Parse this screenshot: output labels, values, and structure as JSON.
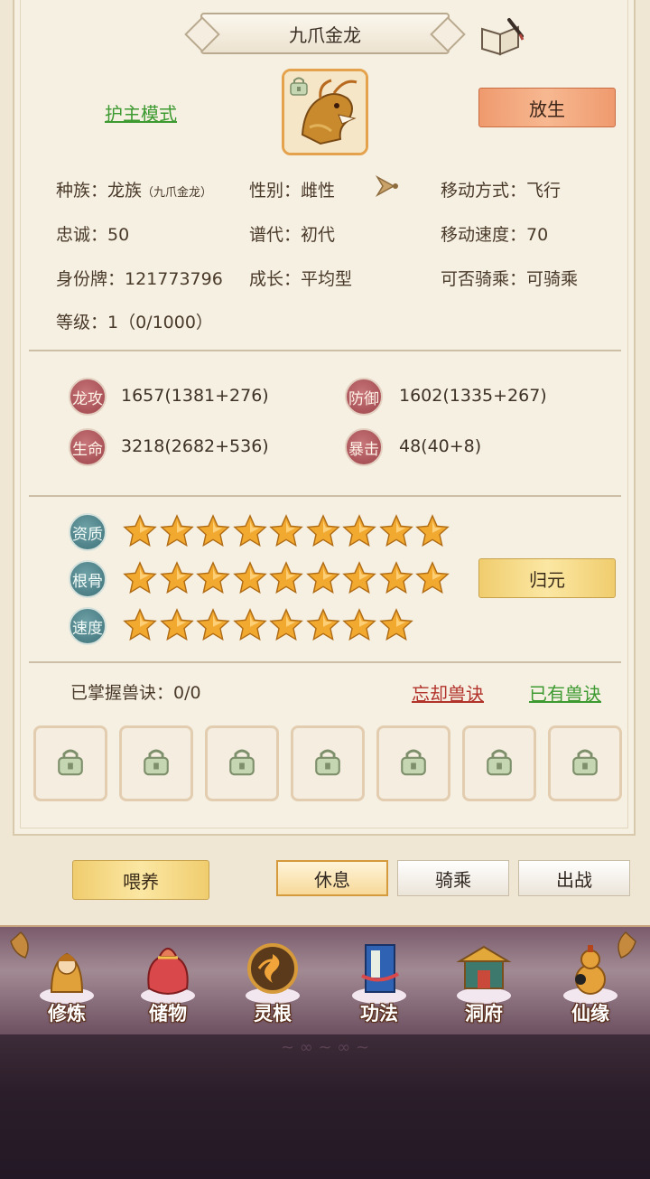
{
  "header": {
    "title": "九爪金龙"
  },
  "top": {
    "mode_link": "护主模式",
    "release_button": "放生"
  },
  "info": {
    "race_label": "种族：",
    "race_value": "龙族",
    "race_sub": "（九爪金龙）",
    "gender": "性别：雌性",
    "move_type": "移动方式：飞行",
    "loyalty": "忠诚：50",
    "generation": "谱代：初代",
    "move_speed": "移动速度：70",
    "id_tag": "身份牌：121773796",
    "growth": "成长：平均型",
    "rideable": "可否骑乘：可骑乘",
    "level": "等级：1（0/1000）"
  },
  "stats": [
    {
      "badge": "龙攻",
      "value": "1657(1381+276)"
    },
    {
      "badge": "防御",
      "value": "1602(1335+267)"
    },
    {
      "badge": "生命",
      "value": "3218(2682+536)"
    },
    {
      "badge": "暴击",
      "value": "48(40+8)"
    }
  ],
  "aptitudes": [
    {
      "badge": "资质",
      "stars": 9
    },
    {
      "badge": "根骨",
      "stars": 9
    },
    {
      "badge": "速度",
      "stars": 8
    }
  ],
  "return_button": "归元",
  "skills": {
    "mastered_label": "已掌握兽诀：0/0",
    "forget_link": "忘却兽诀",
    "owned_link": "已有兽诀",
    "slot_count": 7
  },
  "actions": {
    "feed_button": "喂养",
    "tabs": [
      "休息",
      "骑乘",
      "出战"
    ],
    "active_tab": "休息"
  },
  "dock": [
    {
      "label": "修炼",
      "icon": "cultivate-icon"
    },
    {
      "label": "储物",
      "icon": "storage-bag-icon"
    },
    {
      "label": "灵根",
      "icon": "spirit-root-icon"
    },
    {
      "label": "功法",
      "icon": "technique-book-icon"
    },
    {
      "label": "洞府",
      "icon": "cave-mansion-icon"
    },
    {
      "label": "仙缘",
      "icon": "gourd-icon"
    }
  ],
  "colors": {
    "accent_green": "#3d9a30",
    "accent_red": "#b2332b",
    "star_gold": "#f2a930",
    "badge_red": "#9d4449",
    "badge_teal": "#3d7178"
  }
}
